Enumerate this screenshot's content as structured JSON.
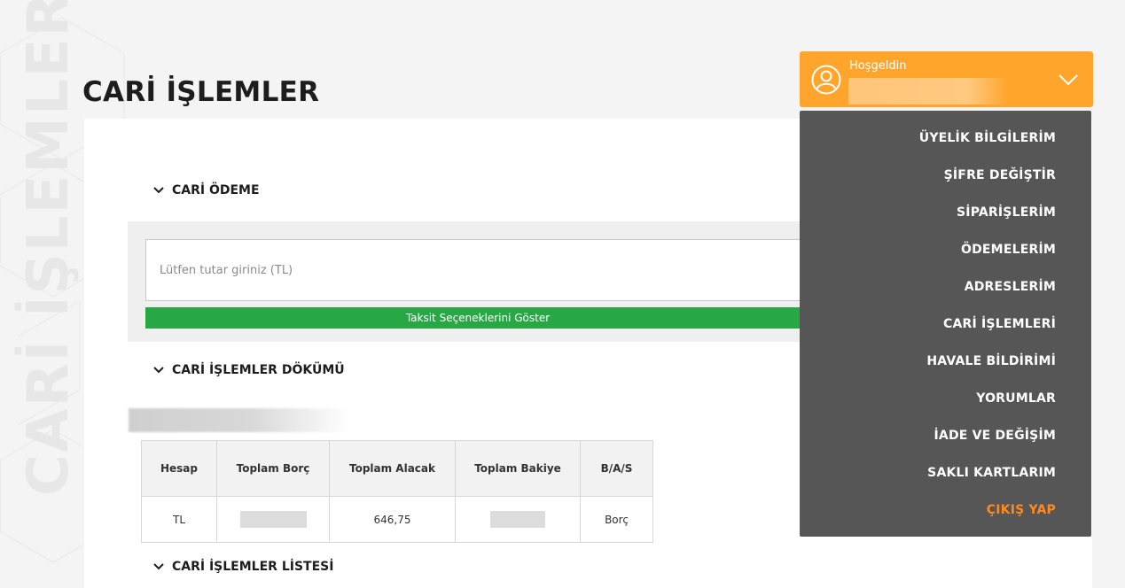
{
  "page": {
    "watermark": "CARİ İŞLEMLER",
    "title": "CARİ İŞLEMLER"
  },
  "payment": {
    "section_title": "CARİ ÖDEME",
    "amount_placeholder": "Lütfen tutar giriniz (TL)",
    "show_installments_label": "Taksit Seçeneklerini Göster",
    "button_color": "#28a745"
  },
  "statement": {
    "section_title": "CARİ İŞLEMLER DÖKÜMÜ",
    "columns": [
      "Hesap",
      "Toplam Borç",
      "Toplam Alacak",
      "Toplam Bakiye",
      "B/A/S"
    ],
    "rows": [
      {
        "account": "TL",
        "total_debt": "",
        "total_credit": "646,75",
        "total_balance": "",
        "bas": "Borç"
      }
    ]
  },
  "list": {
    "section_title": "CARİ İŞLEMLER LİSTESİ"
  },
  "user_menu": {
    "welcome": "Hoşgeldin",
    "accent_color": "#ffa52c",
    "items": [
      {
        "label": "ÜYELİK BİLGİLERİM"
      },
      {
        "label": "ŞİFRE DEĞİŞTİR"
      },
      {
        "label": "SİPARİŞLERİM"
      },
      {
        "label": "ÖDEMELERİM"
      },
      {
        "label": "ADRESLERİM"
      },
      {
        "label": "CARİ İŞLEMLERİ"
      },
      {
        "label": "HAVALE BİLDİRİMİ"
      },
      {
        "label": "YORUMLAR"
      },
      {
        "label": "İADE VE DEĞİŞİM"
      },
      {
        "label": "SAKLI KARTLARIM"
      },
      {
        "label": "ÇIKIŞ YAP"
      }
    ],
    "logout_color": "#ff8a1e",
    "icons": [
      "user-circle-icon",
      "chevron-down-icon"
    ]
  }
}
